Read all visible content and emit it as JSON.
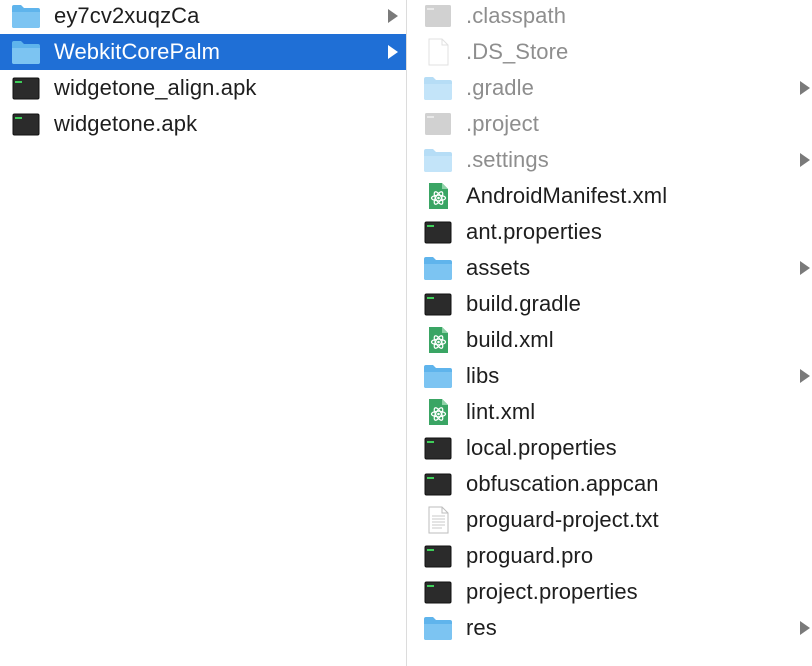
{
  "left_column": {
    "items": [
      {
        "label": "ey7cv2xuqzCa",
        "icon": "folder-icon",
        "type": "folder",
        "has_arrow": true,
        "selected": false
      },
      {
        "label": "WebkitCorePalm",
        "icon": "folder-icon",
        "type": "folder",
        "has_arrow": true,
        "selected": true
      },
      {
        "label": "widgetone_align.apk",
        "icon": "terminal-file-icon",
        "type": "exec",
        "has_arrow": false,
        "selected": false
      },
      {
        "label": "widgetone.apk",
        "icon": "terminal-file-icon",
        "type": "exec",
        "has_arrow": false,
        "selected": false
      }
    ]
  },
  "right_column": {
    "items": [
      {
        "label": ".classpath",
        "icon": "gray-file-icon",
        "type": "gray",
        "dim": true,
        "has_arrow": false
      },
      {
        "label": ".DS_Store",
        "icon": "blank-document-icon",
        "type": "blank",
        "dim": true,
        "has_arrow": false
      },
      {
        "label": ".gradle",
        "icon": "folder-icon",
        "type": "folder",
        "dim": true,
        "has_arrow": true
      },
      {
        "label": ".project",
        "icon": "gray-file-icon",
        "type": "gray",
        "dim": true,
        "has_arrow": false
      },
      {
        "label": ".settings",
        "icon": "folder-icon",
        "type": "folder",
        "dim": true,
        "has_arrow": true
      },
      {
        "label": "AndroidManifest.xml",
        "icon": "atom-document-icon",
        "type": "atom",
        "dim": false,
        "has_arrow": false
      },
      {
        "label": "ant.properties",
        "icon": "terminal-file-icon",
        "type": "exec",
        "dim": false,
        "has_arrow": false
      },
      {
        "label": "assets",
        "icon": "folder-icon",
        "type": "folder",
        "dim": false,
        "has_arrow": true
      },
      {
        "label": "build.gradle",
        "icon": "terminal-file-icon",
        "type": "exec",
        "dim": false,
        "has_arrow": false
      },
      {
        "label": "build.xml",
        "icon": "atom-document-icon",
        "type": "atom",
        "dim": false,
        "has_arrow": false
      },
      {
        "label": "libs",
        "icon": "folder-icon",
        "type": "folder",
        "dim": false,
        "has_arrow": true
      },
      {
        "label": "lint.xml",
        "icon": "atom-document-icon",
        "type": "atom",
        "dim": false,
        "has_arrow": false
      },
      {
        "label": "local.properties",
        "icon": "terminal-file-icon",
        "type": "exec",
        "dim": false,
        "has_arrow": false
      },
      {
        "label": "obfuscation.appcan",
        "icon": "terminal-file-icon",
        "type": "exec",
        "dim": false,
        "has_arrow": false
      },
      {
        "label": "proguard-project.txt",
        "icon": "text-document-icon",
        "type": "text",
        "dim": false,
        "has_arrow": false
      },
      {
        "label": "proguard.pro",
        "icon": "terminal-file-icon",
        "type": "exec",
        "dim": false,
        "has_arrow": false
      },
      {
        "label": "project.properties",
        "icon": "terminal-file-icon",
        "type": "exec",
        "dim": false,
        "has_arrow": false
      },
      {
        "label": "res",
        "icon": "folder-icon",
        "type": "folder",
        "dim": false,
        "has_arrow": true
      }
    ]
  },
  "colors": {
    "selection": "#1f6fd6",
    "folder": "#5fb4ec",
    "terminal": "#2b2b2b",
    "terminal_prompt": "#3fcf5a",
    "atom": "#3aa564"
  }
}
